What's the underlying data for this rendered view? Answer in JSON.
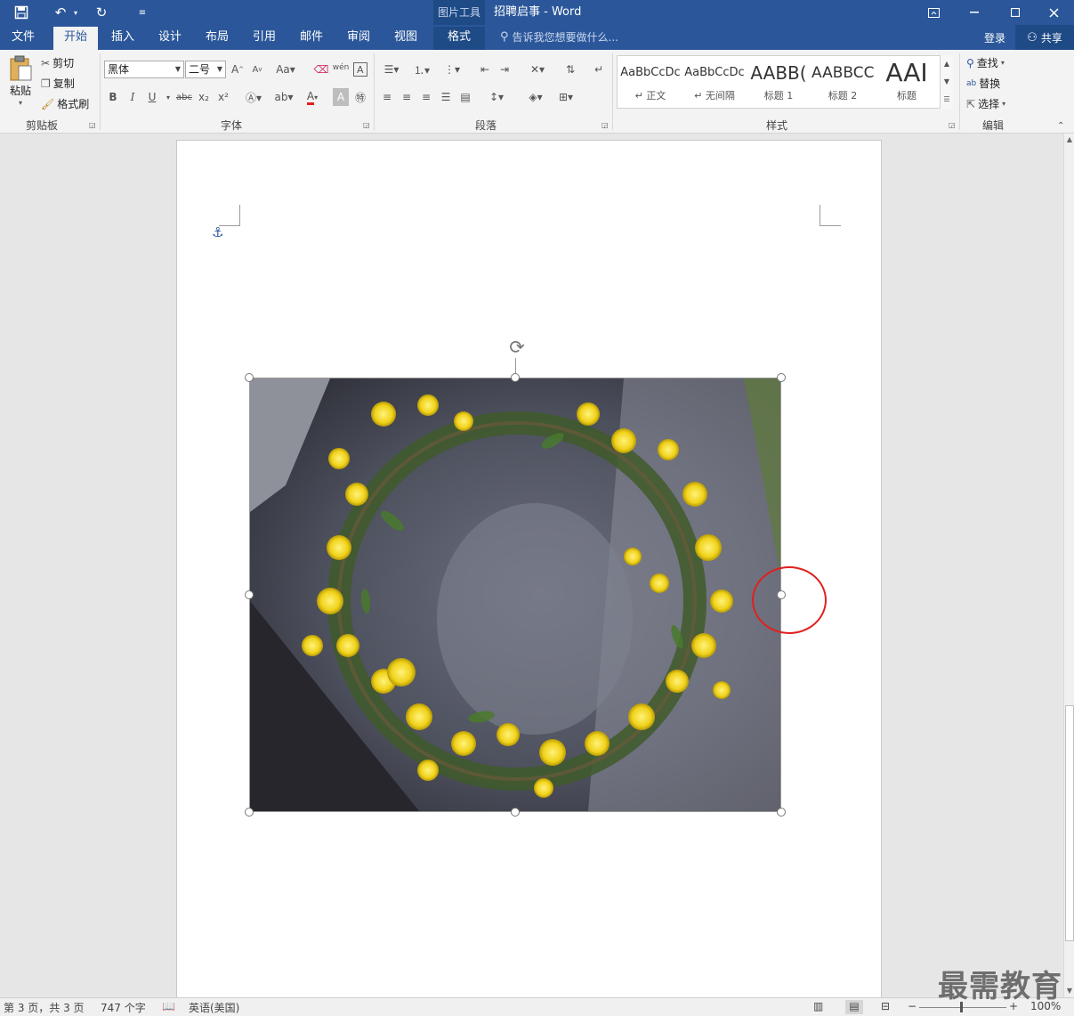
{
  "titlebar": {
    "context_tools": "图片工具",
    "doc_title": "招聘启事 - Word",
    "qa_icons": [
      "save-icon",
      "undo-icon",
      "redo-icon",
      "customize-icon"
    ],
    "win_icons": [
      "ribbon-display-icon",
      "minimize-icon",
      "maximize-icon",
      "close-icon"
    ]
  },
  "tabs": {
    "file": "文件",
    "home": "开始",
    "insert": "插入",
    "design": "设计",
    "layout": "布局",
    "references": "引用",
    "mailings": "邮件",
    "review": "审阅",
    "view": "视图",
    "format": "格式"
  },
  "tellme": "告诉我您想要做什么...",
  "login": "登录",
  "share": "共享",
  "clipboard": {
    "paste": "粘贴",
    "cut": "剪切",
    "copy": "复制",
    "format_painter": "格式刷",
    "label": "剪贴板"
  },
  "font": {
    "name": "黑体",
    "size": "二号",
    "label": "字体",
    "buttons": [
      "B",
      "I",
      "U",
      "abc",
      "x₂",
      "x²"
    ]
  },
  "paragraph": {
    "label": "段落"
  },
  "styles": {
    "label": "样式",
    "items": [
      {
        "sample": "AaBbCcDc",
        "name": "↵ 正文"
      },
      {
        "sample": "AaBbCcDc",
        "name": "↵ 无间隔"
      },
      {
        "sample": "AABB(",
        "name": "标题 1"
      },
      {
        "sample": "AABBCC",
        "name": "标题 2"
      },
      {
        "sample": "AAI",
        "name": "标题"
      }
    ]
  },
  "editing": {
    "find": "查找",
    "replace": "替换",
    "select": "选择",
    "label": "编辑"
  },
  "status": {
    "page": "第 3 页，共 3 页",
    "words": "747 个字",
    "language": "英语(美国)",
    "zoom": "100%"
  },
  "watermark": "最需教育",
  "colors": {
    "accent": "#2b579a",
    "accent_dark": "#1e4a86",
    "highlight_circle": "#e02020"
  }
}
